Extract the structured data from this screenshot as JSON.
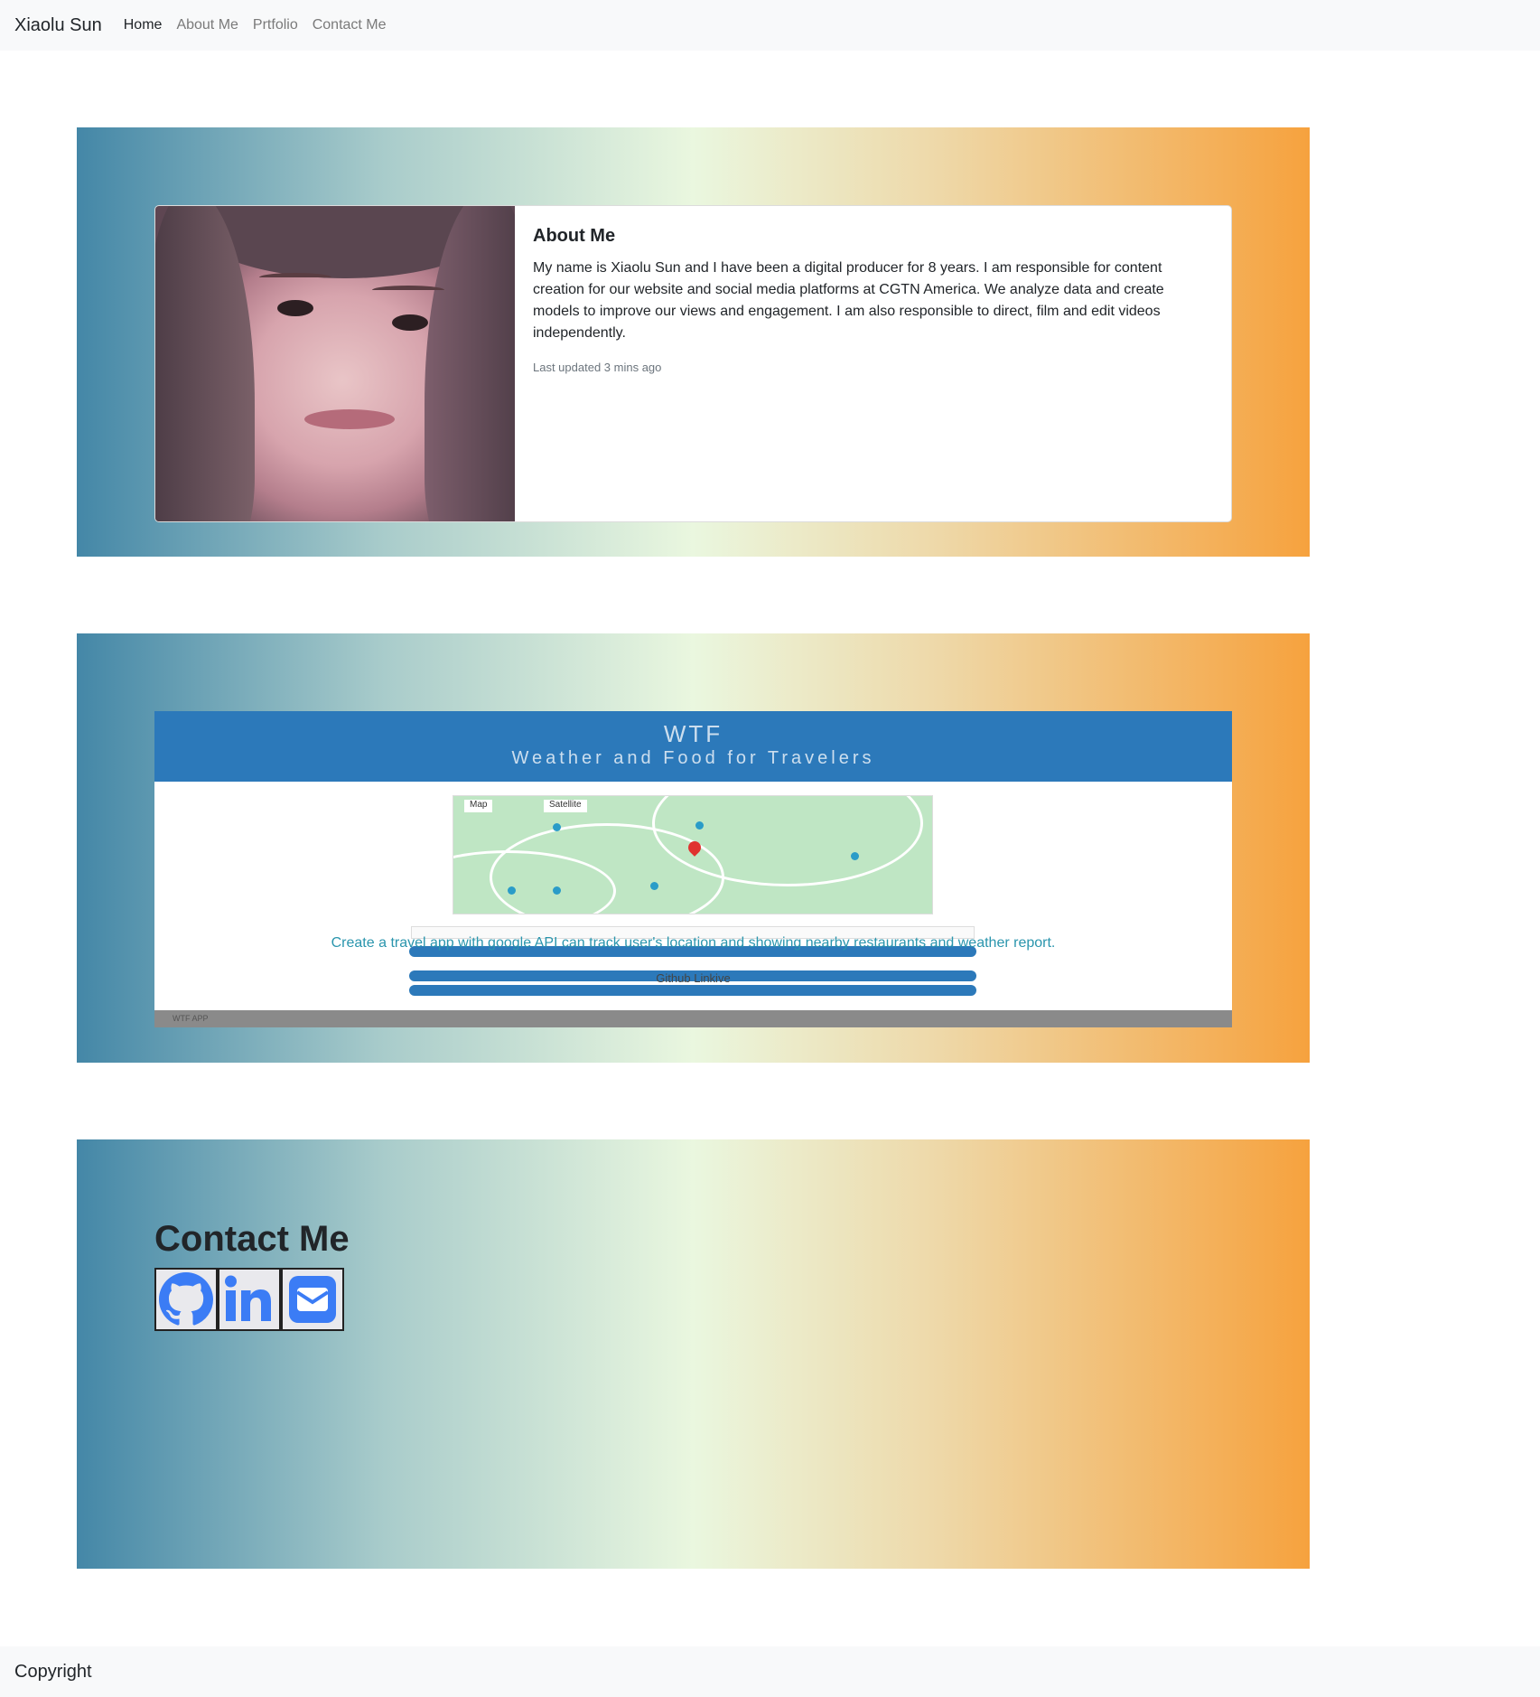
{
  "nav": {
    "brand": "Xiaolu Sun",
    "links": [
      "Home",
      "About Me",
      "Prtfolio",
      "Contact Me"
    ]
  },
  "about": {
    "title": "About Me",
    "text": "My name is Xiaolu Sun and I have been a digital producer for 8 years. I am responsible for content creation for our website and social media platforms at CGTN America. We analyze data and create models to improve our views and engagement. I am also responsible to direct, film and edit videos independently.",
    "updated": "Last updated 3 mins ago"
  },
  "portfolio": {
    "app_title": "WTF",
    "app_subtitle": "Weather and Food for Travelers",
    "map_tabs": [
      "Map",
      "Satellite"
    ],
    "description": "Create a travel app with google API can track user's location and showing nearby restaurants and weather report.",
    "github_link": "Github Linkive",
    "footer": "WTF APP"
  },
  "contact": {
    "title": "Contact Me",
    "icons": [
      "github-icon",
      "linkedin-icon",
      "email-icon"
    ]
  },
  "footer": {
    "text": "Copyright"
  },
  "colors": {
    "gradient_start": "#4487a7",
    "gradient_mid": "#eaf7df",
    "gradient_end": "#f6a23e",
    "icon_blue": "#3b7cf5",
    "app_blue": "#2c79ba"
  }
}
